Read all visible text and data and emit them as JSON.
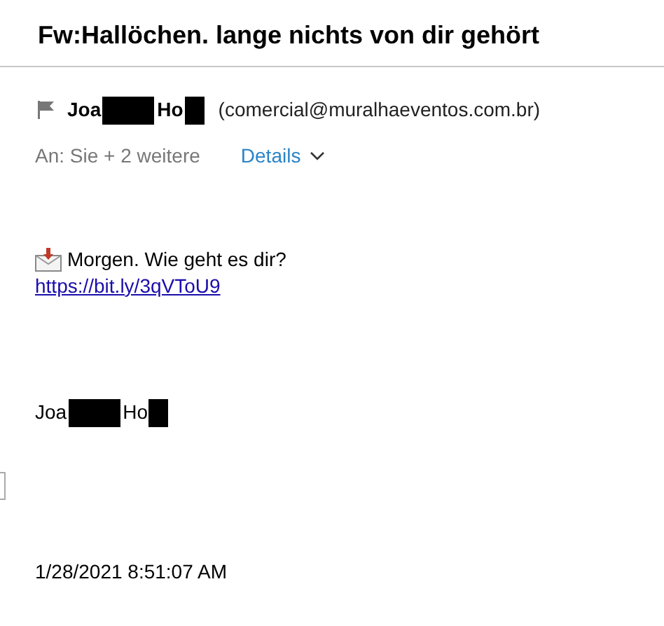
{
  "subject": "Fw:Hallöchen. lange nichts von dir gehört",
  "sender": {
    "name_parts": [
      "Joa",
      "Ho"
    ],
    "email": "(comercial@muralhaeventos.com.br)"
  },
  "recipients": {
    "text": "An: Sie + 2 weitere",
    "details": "Details"
  },
  "body": {
    "line": "Morgen. Wie geht es dir?",
    "link": "https://bit.ly/3qVToU9"
  },
  "signature": {
    "name_parts": [
      "Joa",
      "Ho"
    ]
  },
  "date": "1/28/2021 8:51:07 AM"
}
